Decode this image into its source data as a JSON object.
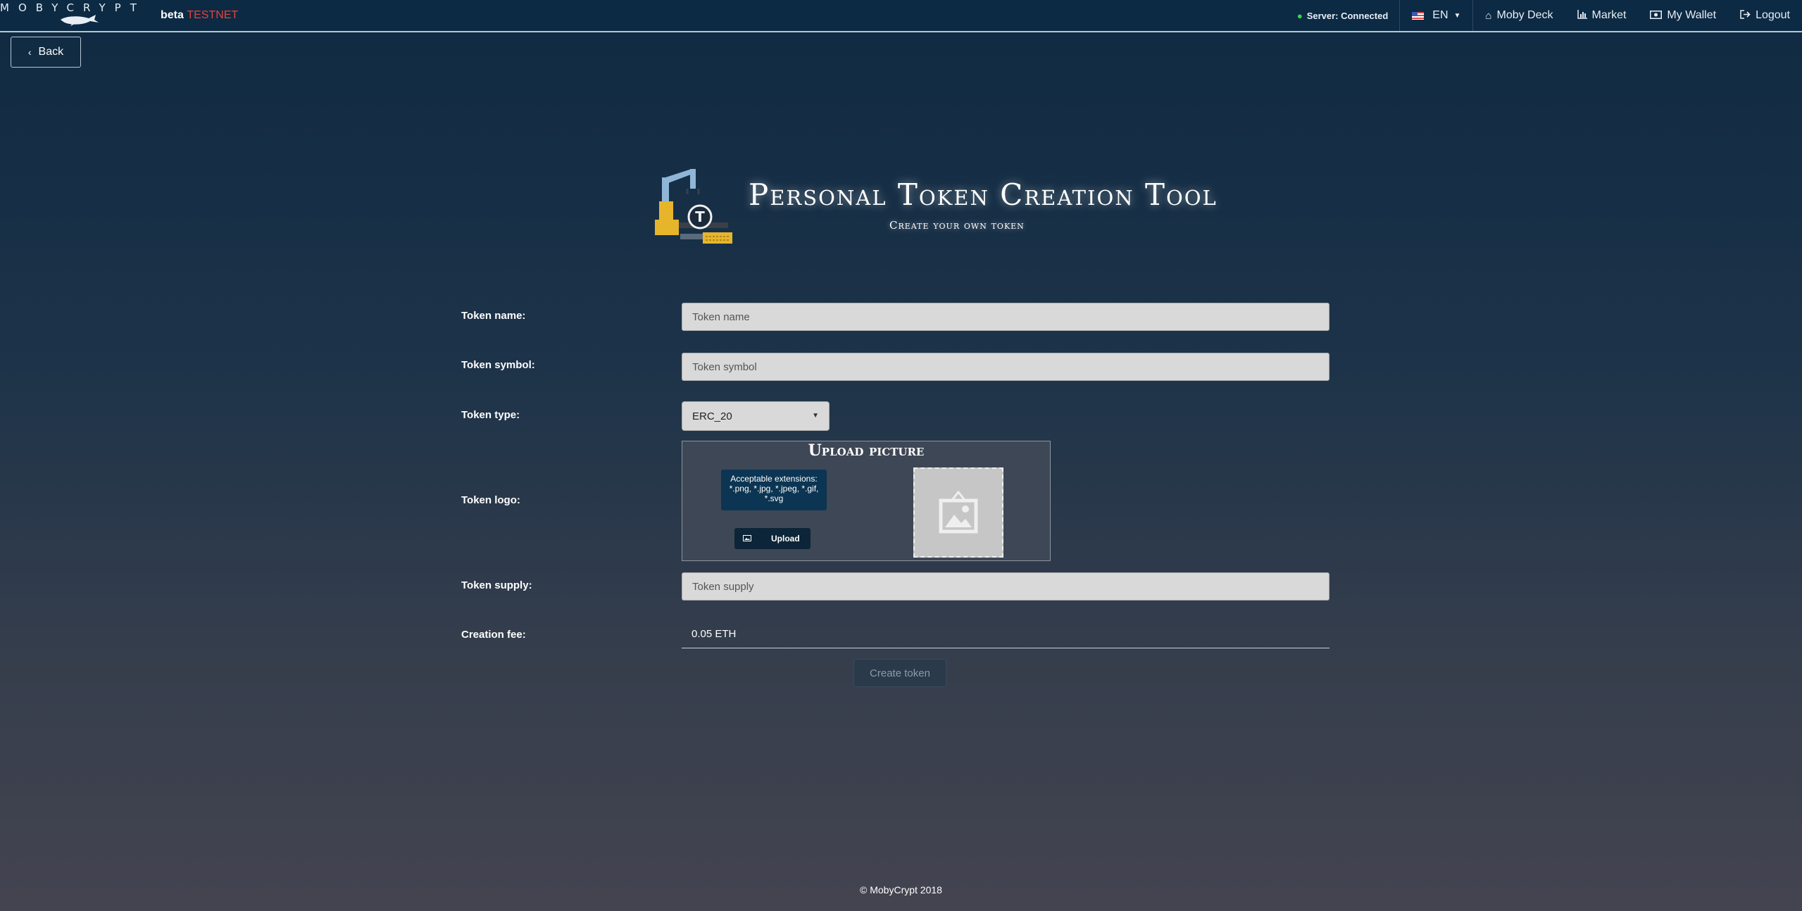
{
  "nav": {
    "brand": "MOBYCRYPT",
    "beta": "beta",
    "env": "TESTNET",
    "server_status": "Server: Connected",
    "language": "EN",
    "items": [
      {
        "label": "Moby Deck",
        "icon": "home-icon"
      },
      {
        "label": "Market",
        "icon": "bar-chart-icon"
      },
      {
        "label": "My Wallet",
        "icon": "money-icon"
      },
      {
        "label": "Logout",
        "icon": "sign-out-icon"
      }
    ]
  },
  "back_label": "Back",
  "header": {
    "title": "Personal Token Creation Tool",
    "subtitle": "Create your own token"
  },
  "form": {
    "token_name": {
      "label": "Token name:",
      "placeholder": "Token name",
      "value": ""
    },
    "token_symbol": {
      "label": "Token symbol:",
      "placeholder": "Token symbol",
      "value": ""
    },
    "token_type": {
      "label": "Token type:",
      "value": "ERC_20"
    },
    "token_logo": {
      "label": "Token logo:",
      "upload_title": "Upload picture",
      "extensions_note": "Acceptable extensions: *.png, *.jpg, *.jpeg, *.gif, *.svg",
      "upload_label": "Upload"
    },
    "token_supply": {
      "label": "Token supply:",
      "placeholder": "Token supply",
      "value": ""
    },
    "creation_fee": {
      "label": "Creation fee:",
      "value": "0.05 ETH"
    },
    "submit_label": "Create token"
  },
  "footer": "© MobyCrypt 2018",
  "colors": {
    "accent": "#0c2a44",
    "testnet": "#e8413b",
    "connected": "#31d843"
  }
}
